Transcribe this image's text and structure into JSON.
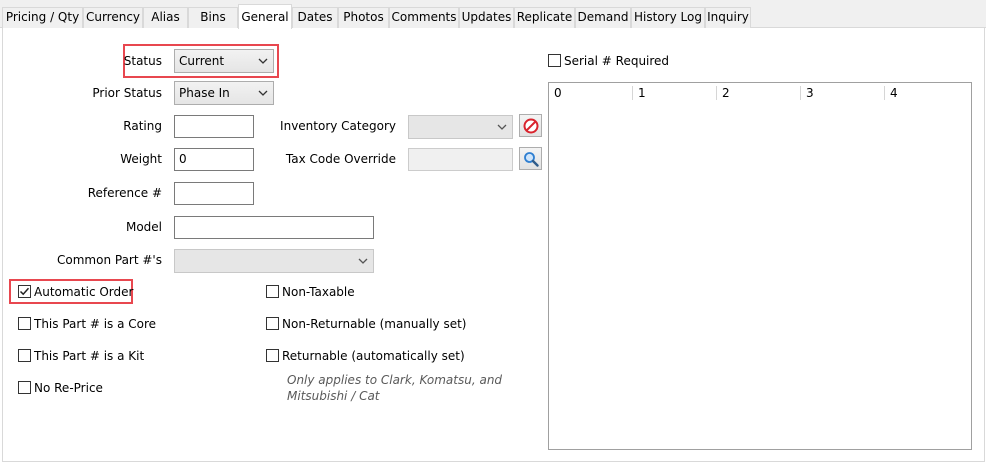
{
  "tabs": [
    {
      "label": "Pricing / Qty",
      "active": false
    },
    {
      "label": "Currency",
      "active": false
    },
    {
      "label": "Alias",
      "active": false
    },
    {
      "label": "Bins",
      "active": false
    },
    {
      "label": "General",
      "active": true
    },
    {
      "label": "Dates",
      "active": false
    },
    {
      "label": "Photos",
      "active": false
    },
    {
      "label": "Comments",
      "active": false
    },
    {
      "label": "Updates",
      "active": false
    },
    {
      "label": "Replicate",
      "active": false
    },
    {
      "label": "Demand",
      "active": false
    },
    {
      "label": "History Log",
      "active": false
    },
    {
      "label": "Inquiry",
      "active": false
    }
  ],
  "form": {
    "status_label": "Status",
    "status_value": "Current",
    "prior_status_label": "Prior Status",
    "prior_status_value": "Phase In",
    "rating_label": "Rating",
    "rating_value": "",
    "weight_label": "Weight",
    "weight_value": "0",
    "reference_label": "Reference #",
    "reference_value": "",
    "model_label": "Model",
    "model_value": "",
    "common_parts_label": "Common Part #'s",
    "common_parts_value": "",
    "inventory_category_label": "Inventory Category",
    "inventory_category_value": "",
    "tax_code_label": "Tax Code Override",
    "tax_code_value": ""
  },
  "checkboxes": {
    "automatic_order": {
      "label": "Automatic Order",
      "checked": true
    },
    "core": {
      "label": "This Part # is a Core",
      "checked": false
    },
    "kit": {
      "label": "This Part # is a Kit",
      "checked": false
    },
    "no_reprice": {
      "label": "No Re-Price",
      "checked": false
    },
    "non_taxable": {
      "label": "Non-Taxable",
      "checked": false
    },
    "non_returnable": {
      "label": "Non-Returnable (manually set)",
      "checked": false
    },
    "returnable": {
      "label": "Returnable (automatically set)",
      "checked": false
    },
    "serial_required": {
      "label": "Serial # Required",
      "checked": false
    }
  },
  "returnable_note": "Only applies to Clark, Komatsu, and Mitsubishi / Cat",
  "serial_grid": {
    "columns": [
      "0",
      "1",
      "2",
      "3",
      "4"
    ]
  },
  "icons": {
    "clear": "no-entry-icon",
    "search": "magnifier-icon"
  },
  "colors": {
    "highlight": "#e8474f",
    "clear_icon": "#d9232d",
    "search_icon": "#2f7fd1"
  }
}
